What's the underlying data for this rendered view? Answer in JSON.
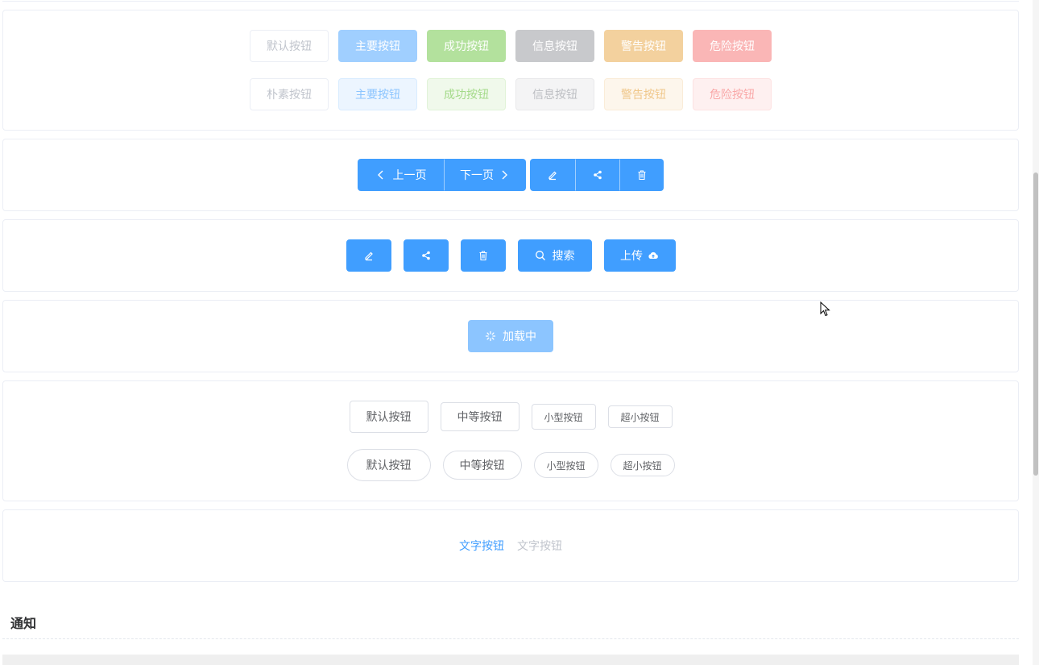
{
  "disabled_buttons": [
    "默认按钮",
    "主要按钮",
    "成功按钮",
    "信息按钮",
    "警告按钮",
    "危险按钮"
  ],
  "plain_disabled_buttons": [
    "朴素按钮",
    "主要按钮",
    "成功按钮",
    "信息按钮",
    "警告按钮",
    "危险按钮"
  ],
  "pagination": {
    "prev": "上一页",
    "next": "下一页"
  },
  "icon_buttons": {
    "search": "搜索",
    "upload": "上传"
  },
  "loading_button": "加载中",
  "sizes": {
    "default": "默认按钮",
    "medium": "中等按钮",
    "small": "小型按钮",
    "mini": "超小按钮"
  },
  "text_buttons": {
    "enabled": "文字按钮",
    "disabled": "文字按钮"
  },
  "section_title": "通知",
  "colors": {
    "primary": "#409eff",
    "success": "#67c23a",
    "info": "#909399",
    "warning": "#e6a23c",
    "danger": "#f56c6c"
  }
}
